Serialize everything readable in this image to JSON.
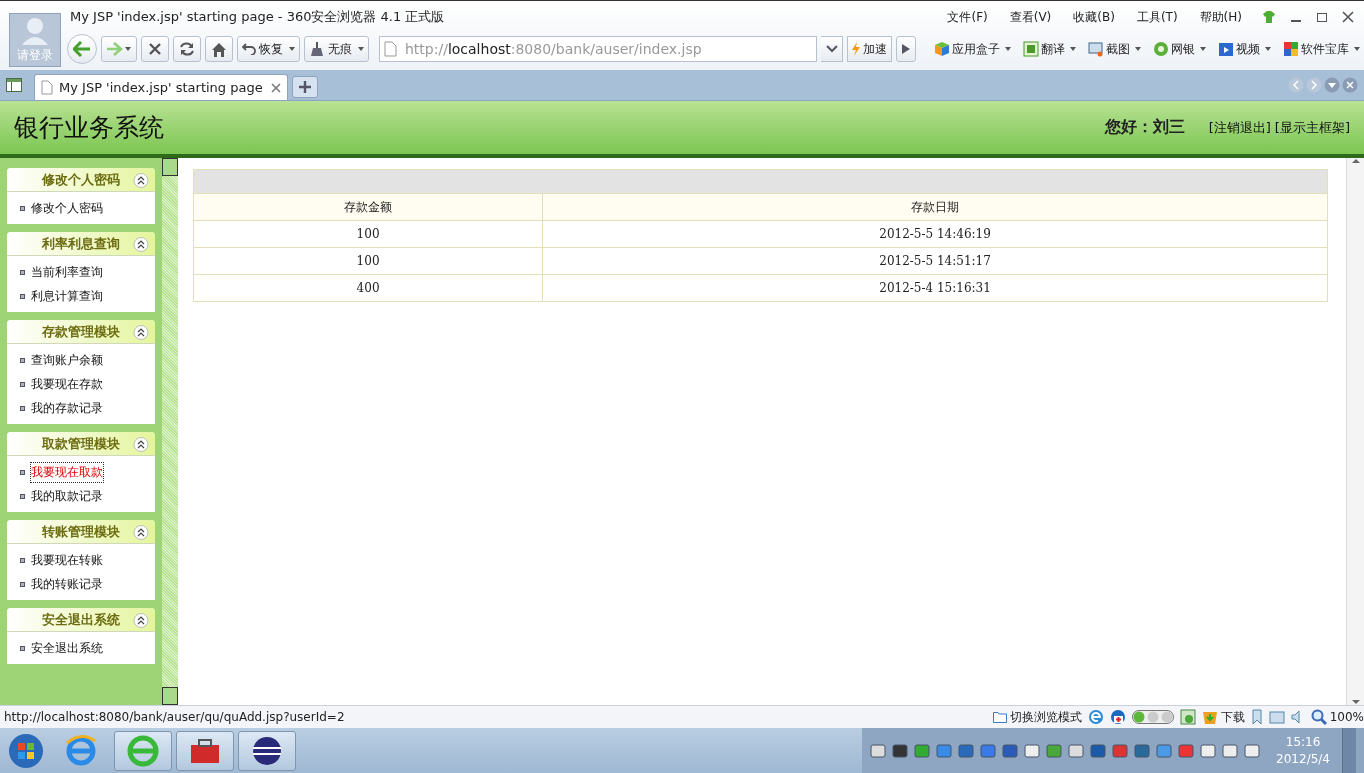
{
  "browser": {
    "title": "My JSP 'index.jsp' starting page - 360安全浏览器 4.1 正式版",
    "login_label": "请登录",
    "menu": [
      "文件(F)",
      "查看(V)",
      "收藏(B)",
      "工具(T)",
      "帮助(H)"
    ],
    "restore_label": "恢复",
    "private_label": "无痕",
    "address": {
      "scheme": "http://",
      "host": "localhost",
      "path": ":8080/bank/auser/index.jsp"
    },
    "speed_label": "加速",
    "toolbar_items": [
      "应用盒子",
      "翻译",
      "截图",
      "网银",
      "视频",
      "软件宝库"
    ]
  },
  "tabs": [
    {
      "label": "My JSP 'index.jsp' starting page",
      "selected": true
    }
  ],
  "page": {
    "title": "银行业务系统",
    "greeting": "您好：刘三",
    "links": [
      "[注销退出]",
      "[显示主框架]"
    ]
  },
  "sidebar": {
    "groups": [
      {
        "title": "修改个人密码",
        "expanded": true,
        "items": [
          {
            "label": "修改个人密码",
            "selected": false
          }
        ]
      },
      {
        "title": "利率利息查询",
        "expanded": true,
        "items": [
          {
            "label": "当前利率查询",
            "selected": false
          },
          {
            "label": "利息计算查询",
            "selected": false
          }
        ]
      },
      {
        "title": "存款管理模块",
        "expanded": true,
        "items": [
          {
            "label": "查询账户余额",
            "selected": false
          },
          {
            "label": "我要现在存款",
            "selected": false
          },
          {
            "label": "我的存款记录",
            "selected": false
          }
        ]
      },
      {
        "title": "取款管理模块",
        "expanded": true,
        "items": [
          {
            "label": "我要现在取款",
            "selected": true
          },
          {
            "label": "我的取款记录",
            "selected": false
          }
        ]
      },
      {
        "title": "转账管理模块",
        "expanded": true,
        "items": [
          {
            "label": "我要现在转账",
            "selected": false
          },
          {
            "label": "我的转账记录",
            "selected": false
          }
        ]
      },
      {
        "title": "安全退出系统",
        "expanded": true,
        "items": [
          {
            "label": "安全退出系统",
            "selected": false
          }
        ]
      }
    ]
  },
  "table": {
    "columns": [
      "存款金额",
      "存款日期"
    ],
    "rows": [
      [
        "100",
        "2012-5-5 14:46:19"
      ],
      [
        "100",
        "2012-5-5 14:51:17"
      ],
      [
        "400",
        "2012-5-4 15:16:31"
      ]
    ]
  },
  "status_bar": {
    "url": "http://localhost:8080/bank/auser/qu/quAdd.jsp?userId=2",
    "mode_label": "切换浏览模式",
    "download_label": "下载",
    "zoom": "100%"
  },
  "taskbar": {
    "time": "15:16",
    "date": "2012/5/4"
  }
}
